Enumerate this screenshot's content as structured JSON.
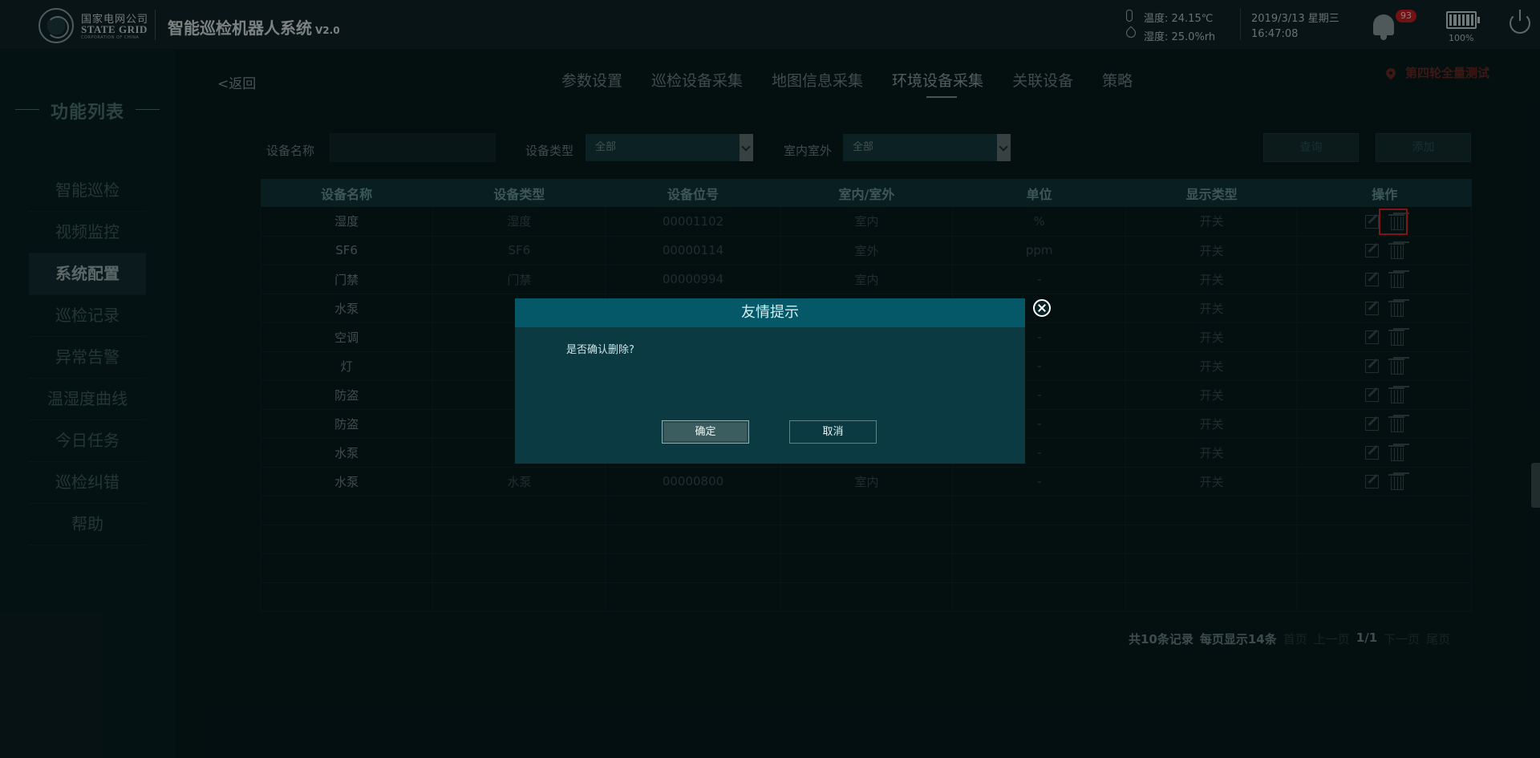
{
  "header": {
    "company_cn": "国家电网公司",
    "company_en": "STATE GRID",
    "company_sub": "CORPORATION OF CHINA",
    "system_title": "智能巡检机器人系统",
    "system_version": "V2.0",
    "temperature": "温度:  24.15℃",
    "humidity": "湿度:  25.0%rh",
    "date": "2019/3/13 星期三",
    "time": "16:47:08",
    "notification_count": "93",
    "battery_level": "100%"
  },
  "sidebar": {
    "title": "功能列表",
    "items": [
      {
        "label": "智能巡检"
      },
      {
        "label": "视频监控"
      },
      {
        "label": "系统配置"
      },
      {
        "label": "巡检记录"
      },
      {
        "label": "异常告警"
      },
      {
        "label": "温湿度曲线"
      },
      {
        "label": "今日任务"
      },
      {
        "label": "巡检纠错"
      },
      {
        "label": "帮助"
      }
    ],
    "active_index": 2
  },
  "nav": {
    "back": "<返回",
    "tabs": [
      "参数设置",
      "巡检设备采集",
      "地图信息采集",
      "环境设备采集",
      "关联设备",
      "策略"
    ],
    "active_tab": 3,
    "location": "第四轮全量测试"
  },
  "filters": {
    "name_label": "设备名称",
    "name_value": "",
    "type_label": "设备类型",
    "type_selected": "全部",
    "inout_label": "室内室外",
    "inout_selected": "全部",
    "query_button": "查询",
    "add_button": "添加"
  },
  "table": {
    "headers": [
      "设备名称",
      "设备类型",
      "设备位号",
      "室内/室外",
      "单位",
      "显示类型",
      "操作"
    ],
    "rows": [
      [
        "湿度",
        "湿度",
        "00001102",
        "室内",
        "%",
        "开关"
      ],
      [
        "SF6",
        "SF6",
        "00000114",
        "室外",
        "ppm",
        "开关"
      ],
      [
        "门禁",
        "门禁",
        "00000994",
        "室内",
        "-",
        "开关"
      ],
      [
        "水泵",
        "",
        "",
        "",
        "",
        "开关"
      ],
      [
        "空调",
        "",
        "",
        "",
        "-",
        "开关"
      ],
      [
        "灯",
        "",
        "",
        "",
        "-",
        "开关"
      ],
      [
        "防盗",
        "",
        "",
        "",
        "-",
        "开关"
      ],
      [
        "防盗",
        "",
        "",
        "",
        "-",
        "开关"
      ],
      [
        "水泵",
        "",
        "",
        "",
        "-",
        "开关"
      ],
      [
        "水泵",
        "水泵",
        "00000800",
        "室内",
        "-",
        "开关"
      ]
    ]
  },
  "pagination": {
    "summary_total": "共10条记录",
    "summary_per_page": "每页显示14条",
    "first": "首页",
    "prev": "上一页",
    "current": "1/1",
    "next": "下一页",
    "last": "尾页"
  },
  "dialog": {
    "title": "友情提示",
    "message": "是否确认删除?",
    "confirm": "确定",
    "cancel": "取消"
  }
}
